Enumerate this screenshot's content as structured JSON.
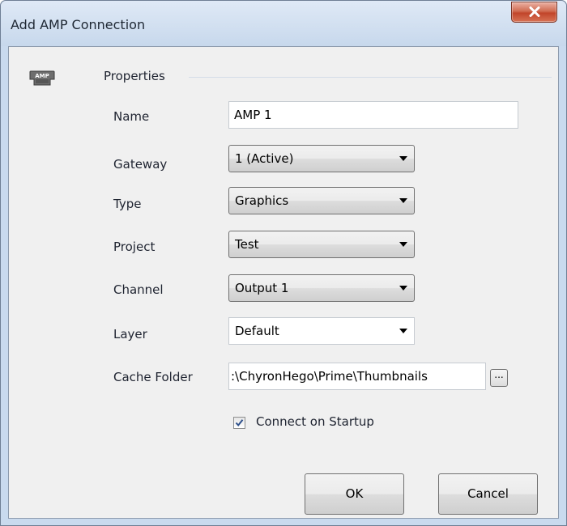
{
  "window": {
    "title": "Add AMP Connection"
  },
  "group": {
    "icon_text": "AMP",
    "label": "Properties"
  },
  "fields": {
    "name": {
      "label": "Name",
      "value": "AMP 1"
    },
    "gateway": {
      "label": "Gateway",
      "value": "1 (Active)"
    },
    "type": {
      "label": "Type",
      "value": "Graphics"
    },
    "project": {
      "label": "Project",
      "value": "Test"
    },
    "channel": {
      "label": "Channel",
      "value": "Output 1"
    },
    "layer": {
      "label": "Layer",
      "value": "Default"
    },
    "cache_folder": {
      "label": "Cache Folder",
      "value": ":\\ChyronHego\\Prime\\Thumbnails",
      "browse_label": "..."
    }
  },
  "connect_on_startup": {
    "label": "Connect on Startup",
    "checked": true
  },
  "buttons": {
    "ok": "OK",
    "cancel": "Cancel"
  },
  "colors": {
    "title_bar": "#c9daee",
    "close_button": "#c9452a",
    "client_bg": "#f0f0f0"
  }
}
